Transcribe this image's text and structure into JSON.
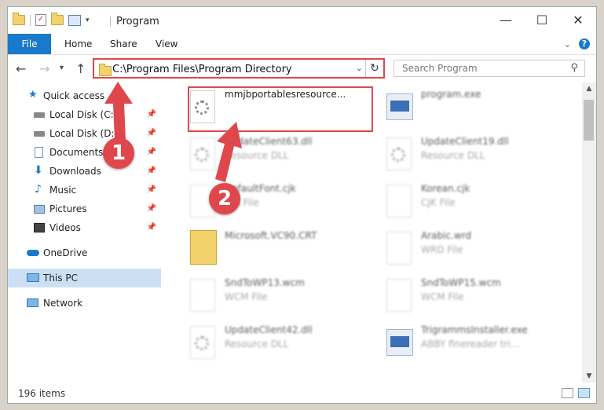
{
  "window": {
    "title": "Program",
    "controls": {
      "minimize": "—",
      "maximize": "☐",
      "close": "✕"
    }
  },
  "ribbon": {
    "tabs": [
      "File",
      "Home",
      "Share",
      "View"
    ],
    "expand_icon": "chevron-down-icon",
    "help_label": "?"
  },
  "address": {
    "path": "C:\\Program Files\\Program Directory",
    "refresh_icon": "refresh-icon"
  },
  "search": {
    "placeholder": "Search Program"
  },
  "sidebar": {
    "items": [
      {
        "label": "Quick access",
        "icon": "star-icon",
        "pinned": false
      },
      {
        "label": "Local Disk (C:)",
        "icon": "drive-icon",
        "pinned": true
      },
      {
        "label": "Local Disk (D:)",
        "icon": "drive-icon",
        "pinned": true
      },
      {
        "label": "Documents",
        "icon": "documents-icon",
        "pinned": true
      },
      {
        "label": "Downloads",
        "icon": "download-icon",
        "pinned": true
      },
      {
        "label": "Music",
        "icon": "music-icon",
        "pinned": true
      },
      {
        "label": "Pictures",
        "icon": "pictures-icon",
        "pinned": true
      },
      {
        "label": "Videos",
        "icon": "videos-icon",
        "pinned": true
      },
      {
        "label": "OneDrive",
        "icon": "cloud-icon",
        "pinned": false
      },
      {
        "label": "This PC",
        "icon": "computer-icon",
        "pinned": false,
        "selected": true
      },
      {
        "label": "Network",
        "icon": "network-icon",
        "pinned": false
      }
    ]
  },
  "files": [
    {
      "name": "mmjbportablesresource...",
      "type": "",
      "icon": "gear-file-icon"
    },
    {
      "name": "program.exe",
      "type": "",
      "icon": "app-icon"
    },
    {
      "name": "UpdateClient63.dll",
      "type": "Resource DLL",
      "icon": "gear-file-icon"
    },
    {
      "name": "UpdateClient19.dll",
      "type": "Resource DLL",
      "icon": "gear-file-icon"
    },
    {
      "name": "DefaultFont.cjk",
      "type": "CJK File",
      "icon": "file-icon"
    },
    {
      "name": "Korean.cjk",
      "type": "CJK File",
      "icon": "file-icon"
    },
    {
      "name": "Microsoft.VC90.CRT",
      "type": "",
      "icon": "folder-icon"
    },
    {
      "name": "Arabic.wrd",
      "type": "WRD File",
      "icon": "file-icon"
    },
    {
      "name": "SndToWP13.wcm",
      "type": "WCM File",
      "icon": "file-icon"
    },
    {
      "name": "SndToWP15.wcm",
      "type": "WCM File",
      "icon": "file-icon"
    },
    {
      "name": "UpdateClient42.dll",
      "type": "Resource DLL",
      "icon": "gear-file-icon"
    },
    {
      "name": "TrigrammsInstaller.exe",
      "type": "ABBY finereader tri...",
      "icon": "app-icon"
    }
  ],
  "status": {
    "item_count": "196 items"
  },
  "annotations": {
    "step1": "1",
    "step2": "2",
    "color": "#e0474c"
  },
  "colors": {
    "accent": "#1979ca",
    "highlight": "#e0474c",
    "selected": "#cce0f5"
  }
}
